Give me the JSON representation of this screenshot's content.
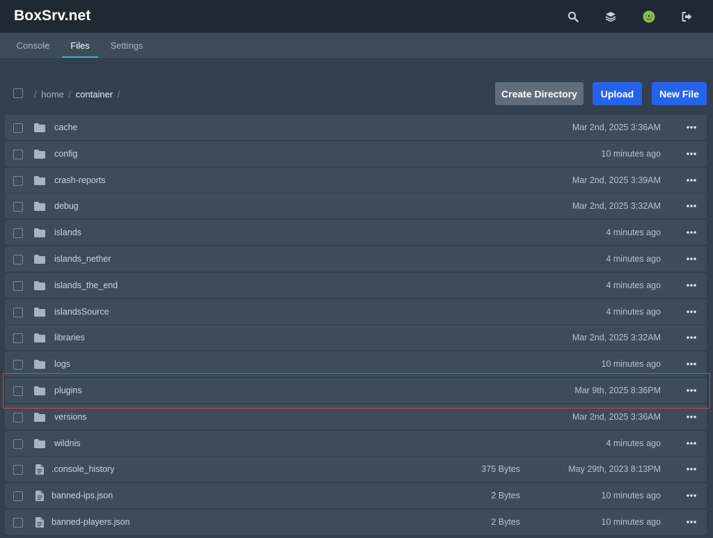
{
  "app": {
    "title": "BoxSrv.net"
  },
  "header": {
    "icons": [
      "search-icon",
      "layers-icon",
      "avatar-icon",
      "logout-icon"
    ]
  },
  "nav": {
    "tabs": [
      {
        "label": "Console",
        "active": false
      },
      {
        "label": "Files",
        "active": true
      },
      {
        "label": "Settings",
        "active": false
      }
    ]
  },
  "breadcrumb": {
    "home": "home",
    "current": "container",
    "separator": "/"
  },
  "actions": {
    "create_directory": "Create Directory",
    "upload": "Upload",
    "new_file": "New File"
  },
  "files": [
    {
      "name": "cache",
      "type": "folder",
      "size": "",
      "modified": "Mar 2nd, 2025 3:36AM"
    },
    {
      "name": "config",
      "type": "folder",
      "size": "",
      "modified": "10 minutes ago"
    },
    {
      "name": "crash-reports",
      "type": "folder",
      "size": "",
      "modified": "Mar 2nd, 2025 3:39AM"
    },
    {
      "name": "debug",
      "type": "folder",
      "size": "",
      "modified": "Mar 2nd, 2025 3:32AM"
    },
    {
      "name": "islands",
      "type": "folder",
      "size": "",
      "modified": "4 minutes ago"
    },
    {
      "name": "islands_nether",
      "type": "folder",
      "size": "",
      "modified": "4 minutes ago"
    },
    {
      "name": "islands_the_end",
      "type": "folder",
      "size": "",
      "modified": "4 minutes ago"
    },
    {
      "name": "islandsSource",
      "type": "folder",
      "size": "",
      "modified": "4 minutes ago"
    },
    {
      "name": "libraries",
      "type": "folder",
      "size": "",
      "modified": "Mar 2nd, 2025 3:32AM"
    },
    {
      "name": "logs",
      "type": "folder",
      "size": "",
      "modified": "10 minutes ago"
    },
    {
      "name": "plugins",
      "type": "folder",
      "size": "",
      "modified": "Mar 9th, 2025 8:36PM",
      "highlighted": true
    },
    {
      "name": "versions",
      "type": "folder",
      "size": "",
      "modified": "Mar 2nd, 2025 3:36AM"
    },
    {
      "name": "wildnis",
      "type": "folder",
      "size": "",
      "modified": "4 minutes ago"
    },
    {
      "name": ".console_history",
      "type": "file",
      "size": "375 Bytes",
      "modified": "May 29th, 2023 8:13PM"
    },
    {
      "name": "banned-ips.json",
      "type": "file",
      "size": "2 Bytes",
      "modified": "10 minutes ago"
    },
    {
      "name": "banned-players.json",
      "type": "file",
      "size": "2 Bytes",
      "modified": "10 minutes ago"
    }
  ],
  "colors": {
    "topbar": "#1f2933",
    "subnav": "#3e4c5a",
    "background": "#33404d",
    "primary": "#2563eb",
    "secondary_button": "#606d7b",
    "tab_accent": "#3ab0c8",
    "highlight_border": "#c24b52"
  }
}
